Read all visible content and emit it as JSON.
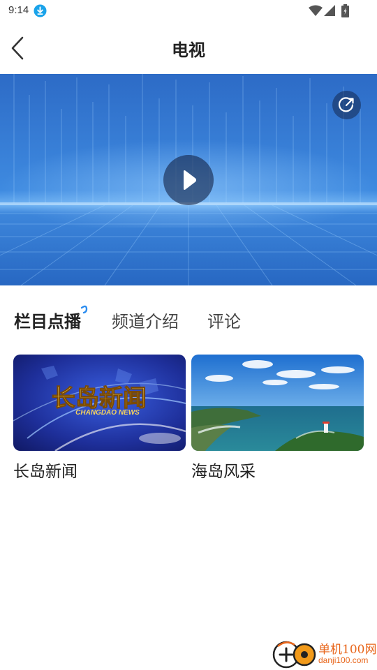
{
  "status": {
    "time": "9:14",
    "download_icon": "download-circle-icon",
    "icons": [
      "wifi-icon",
      "signal-icon",
      "battery-icon"
    ]
  },
  "nav": {
    "title": "电视",
    "back_icon": "chevron-left-icon"
  },
  "player": {
    "play_icon": "play-icon",
    "share_icon": "share-icon"
  },
  "tabs": [
    {
      "label": "栏目点播",
      "active": true
    },
    {
      "label": "频道介绍",
      "active": false
    },
    {
      "label": "评论",
      "active": false
    }
  ],
  "programs": [
    {
      "label": "长岛新闻",
      "thumb_title": "长岛新闻",
      "thumb_subtitle": "CHANGDAO NEWS"
    },
    {
      "label": "海岛风采"
    }
  ],
  "watermark": {
    "line1": "单机100网",
    "line2": "danji100.com"
  },
  "colors": {
    "accent": "#2a8cf0",
    "player_blue": "#2f73cf",
    "watermark": "#e8651a"
  }
}
